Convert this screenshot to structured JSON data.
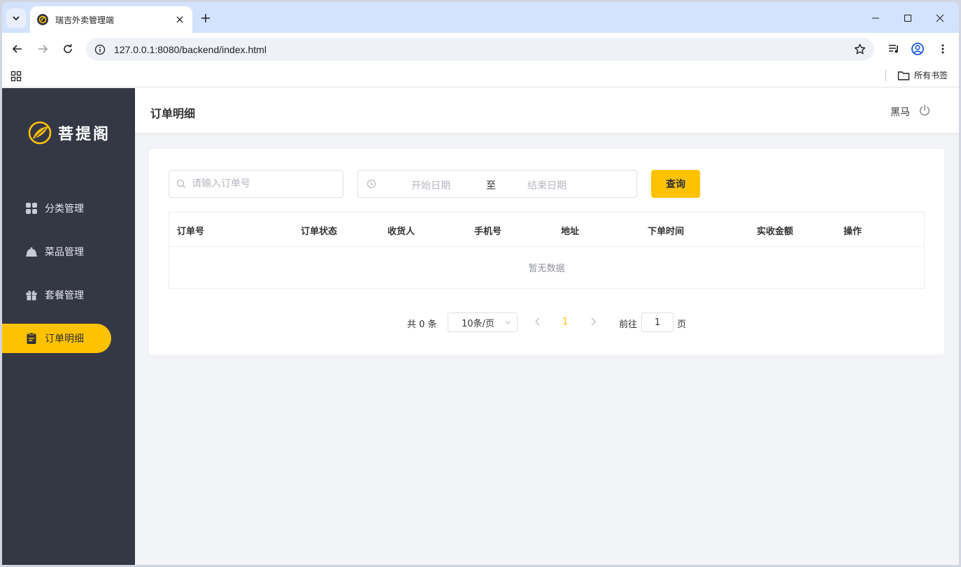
{
  "browser": {
    "tab_title": "瑞吉外卖管理端",
    "url": "127.0.0.1:8080/backend/index.html",
    "bookmarks_folder": "所有书签"
  },
  "sidebar": {
    "logo_text": "菩提阁",
    "items": [
      {
        "label": "分类管理",
        "icon": "category-grid-icon",
        "active": false
      },
      {
        "label": "菜品管理",
        "icon": "dish-cloche-icon",
        "active": false
      },
      {
        "label": "套餐管理",
        "icon": "gift-package-icon",
        "active": false
      },
      {
        "label": "订单明细",
        "icon": "clipboard-order-icon",
        "active": true
      }
    ]
  },
  "header": {
    "title": "订单明细",
    "user_name": "黑马"
  },
  "filters": {
    "order_placeholder": "请输入订单号",
    "date_start_placeholder": "开始日期",
    "date_separator": "至",
    "date_end_placeholder": "结束日期",
    "query_label": "查询"
  },
  "table": {
    "columns": [
      "订单号",
      "订单状态",
      "收货人",
      "手机号",
      "地址",
      "下单时间",
      "实收金额",
      "操作"
    ],
    "empty_text": "暂无数据"
  },
  "pagination": {
    "total_text": "共 0 条",
    "page_size": "10条/页",
    "current_page": "1",
    "jump_label": "前往",
    "jump_value": "1",
    "jump_unit": "页"
  },
  "colors": {
    "accent": "#ffc200",
    "sidebar_bg": "#343744",
    "page_bg": "#f3f4f7"
  }
}
